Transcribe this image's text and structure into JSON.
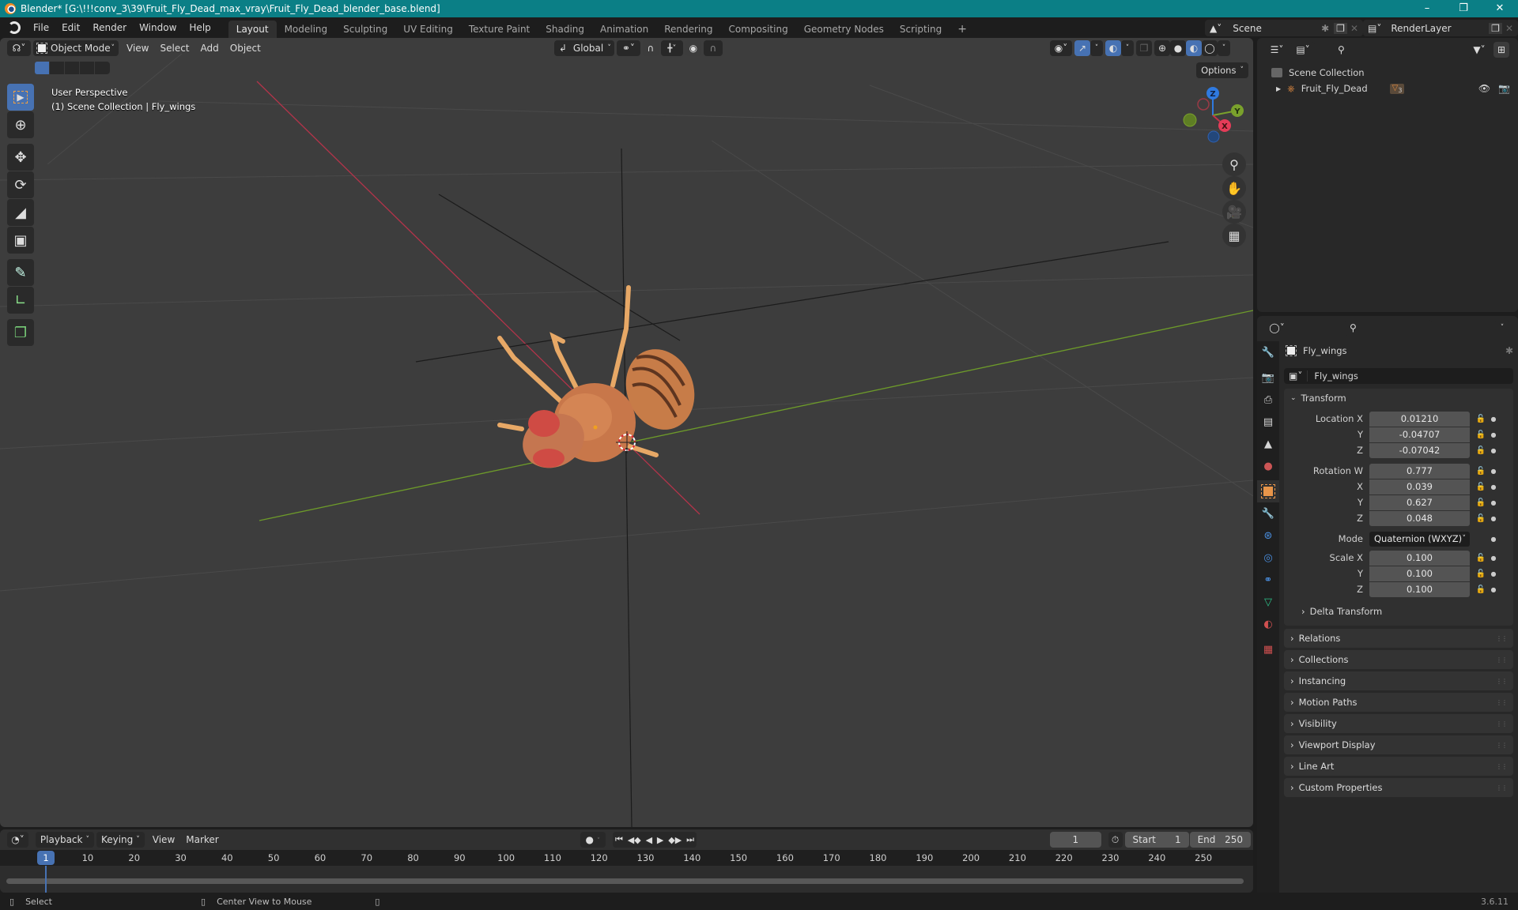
{
  "title_bar": {
    "title": "Blender* [G:\\!!!conv_3\\39\\Fruit_Fly_Dead_max_vray\\Fruit_Fly_Dead_blender_base.blend]",
    "controls": [
      "minimize",
      "maximize",
      "close"
    ]
  },
  "menu": {
    "items": [
      "File",
      "Edit",
      "Render",
      "Window",
      "Help"
    ],
    "workspaces": [
      "Layout",
      "Modeling",
      "Sculpting",
      "UV Editing",
      "Texture Paint",
      "Shading",
      "Animation",
      "Rendering",
      "Compositing",
      "Geometry Nodes",
      "Scripting"
    ],
    "active_workspace": "Layout",
    "add_workspace": "+",
    "scene": "Scene",
    "render_layer": "RenderLayer"
  },
  "viewport": {
    "header": {
      "mode": "Object Mode",
      "menus": [
        "View",
        "Select",
        "Add",
        "Object"
      ],
      "transform_orientation": "Global",
      "options_label": "Options"
    },
    "info_line1": "User Perspective",
    "info_line2": "(1) Scene Collection | Fly_wings",
    "tools": [
      "select-box",
      "cursor",
      "move",
      "rotate",
      "scale",
      "transform",
      "annotate",
      "measure",
      "add-cube"
    ],
    "gizmo_axes": [
      "X",
      "Y",
      "Z"
    ],
    "nav_icons": [
      "zoom",
      "pan",
      "camera",
      "ortho-grid"
    ],
    "colors": {
      "x_axis": "#c4324a",
      "y_axis": "#7aa12c",
      "z_axis": "#2f7ae0",
      "background": "#3d3d3d"
    }
  },
  "outliner": {
    "root": "Scene Collection",
    "items": [
      {
        "name": "Fruit_Fly_Dead",
        "children_badge": "3"
      }
    ]
  },
  "properties": {
    "object_name": "Fly_wings",
    "object_field": "Fly_wings",
    "transform": {
      "title": "Transform",
      "location": {
        "label": "Location X",
        "x": "0.01210",
        "y": "-0.04707",
        "z": "-0.07042"
      },
      "rotation": {
        "label": "Rotation W",
        "w": "0.777",
        "x": "0.039",
        "y": "0.627",
        "z": "0.048"
      },
      "mode_label": "Mode",
      "mode": "Quaternion (WXYZ)",
      "scale": {
        "label": "Scale X",
        "x": "0.100",
        "y": "0.100",
        "z": "0.100"
      },
      "axis_labels": {
        "x": "X",
        "y": "Y",
        "z": "Z"
      }
    },
    "delta_transform": "Delta Transform",
    "panels": [
      "Relations",
      "Collections",
      "Instancing",
      "Motion Paths",
      "Visibility",
      "Viewport Display",
      "Line Art",
      "Custom Properties"
    ]
  },
  "timeline": {
    "menus": [
      "Playback",
      "Keying",
      "View",
      "Marker"
    ],
    "current_frame": "1",
    "start_label": "Start",
    "start": "1",
    "end_label": "End",
    "end": "250",
    "ticks": [
      "10",
      "20",
      "30",
      "40",
      "50",
      "60",
      "70",
      "80",
      "90",
      "100",
      "110",
      "120",
      "130",
      "140",
      "150",
      "160",
      "170",
      "180",
      "190",
      "200",
      "210",
      "220",
      "230",
      "240",
      "250"
    ]
  },
  "status_bar": {
    "select": "Select",
    "center_view": "Center View to Mouse",
    "version": "3.6.11"
  }
}
